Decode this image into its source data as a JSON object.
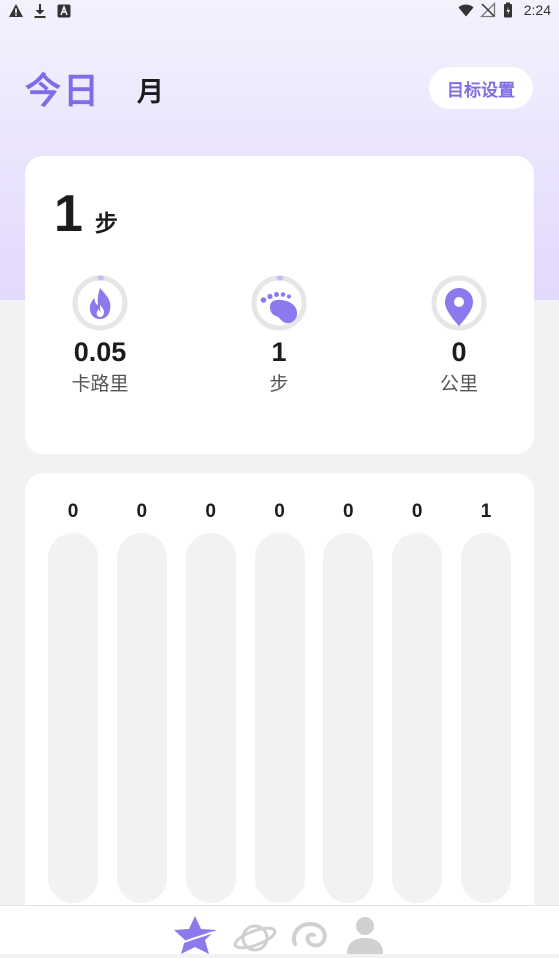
{
  "status_bar": {
    "time": "2:24",
    "icons_left": [
      "warning-icon",
      "download-icon",
      "app-notification-icon"
    ],
    "icons_right": [
      "wifi-icon",
      "no-signal-icon",
      "battery-icon"
    ]
  },
  "header": {
    "tab_today": "今日",
    "tab_month": "月",
    "goal_button": "目标设置"
  },
  "summary": {
    "steps_value": "1",
    "steps_unit": "步",
    "metrics": [
      {
        "value": "0.05",
        "label": "卡路里",
        "icon": "flame-icon",
        "progress": 0.01
      },
      {
        "value": "1",
        "label": "步",
        "icon": "footprint-icon",
        "progress": 0.01
      },
      {
        "value": "0",
        "label": "公里",
        "icon": "location-pin-icon",
        "progress": 0
      }
    ]
  },
  "chart_data": {
    "type": "bar",
    "categories": [
      "",
      "",
      "",
      "",
      "",
      "",
      ""
    ],
    "values": [
      0,
      0,
      0,
      0,
      0,
      0,
      1
    ],
    "value_labels": [
      "0",
      "0",
      "0",
      "0",
      "0",
      "0",
      "1"
    ],
    "title": "",
    "xlabel": "",
    "ylabel": "",
    "grid": false,
    "legend": "none"
  },
  "bottom_nav": {
    "items": [
      {
        "icon": "star-icon",
        "active": true
      },
      {
        "icon": "planet-icon",
        "active": false
      },
      {
        "icon": "swirl-icon",
        "active": false
      },
      {
        "icon": "user-icon",
        "active": false
      }
    ]
  },
  "colors": {
    "accent": "#7f6ce6",
    "ring_track": "#e6e6e6",
    "bar_track": "#f2f2f2"
  }
}
